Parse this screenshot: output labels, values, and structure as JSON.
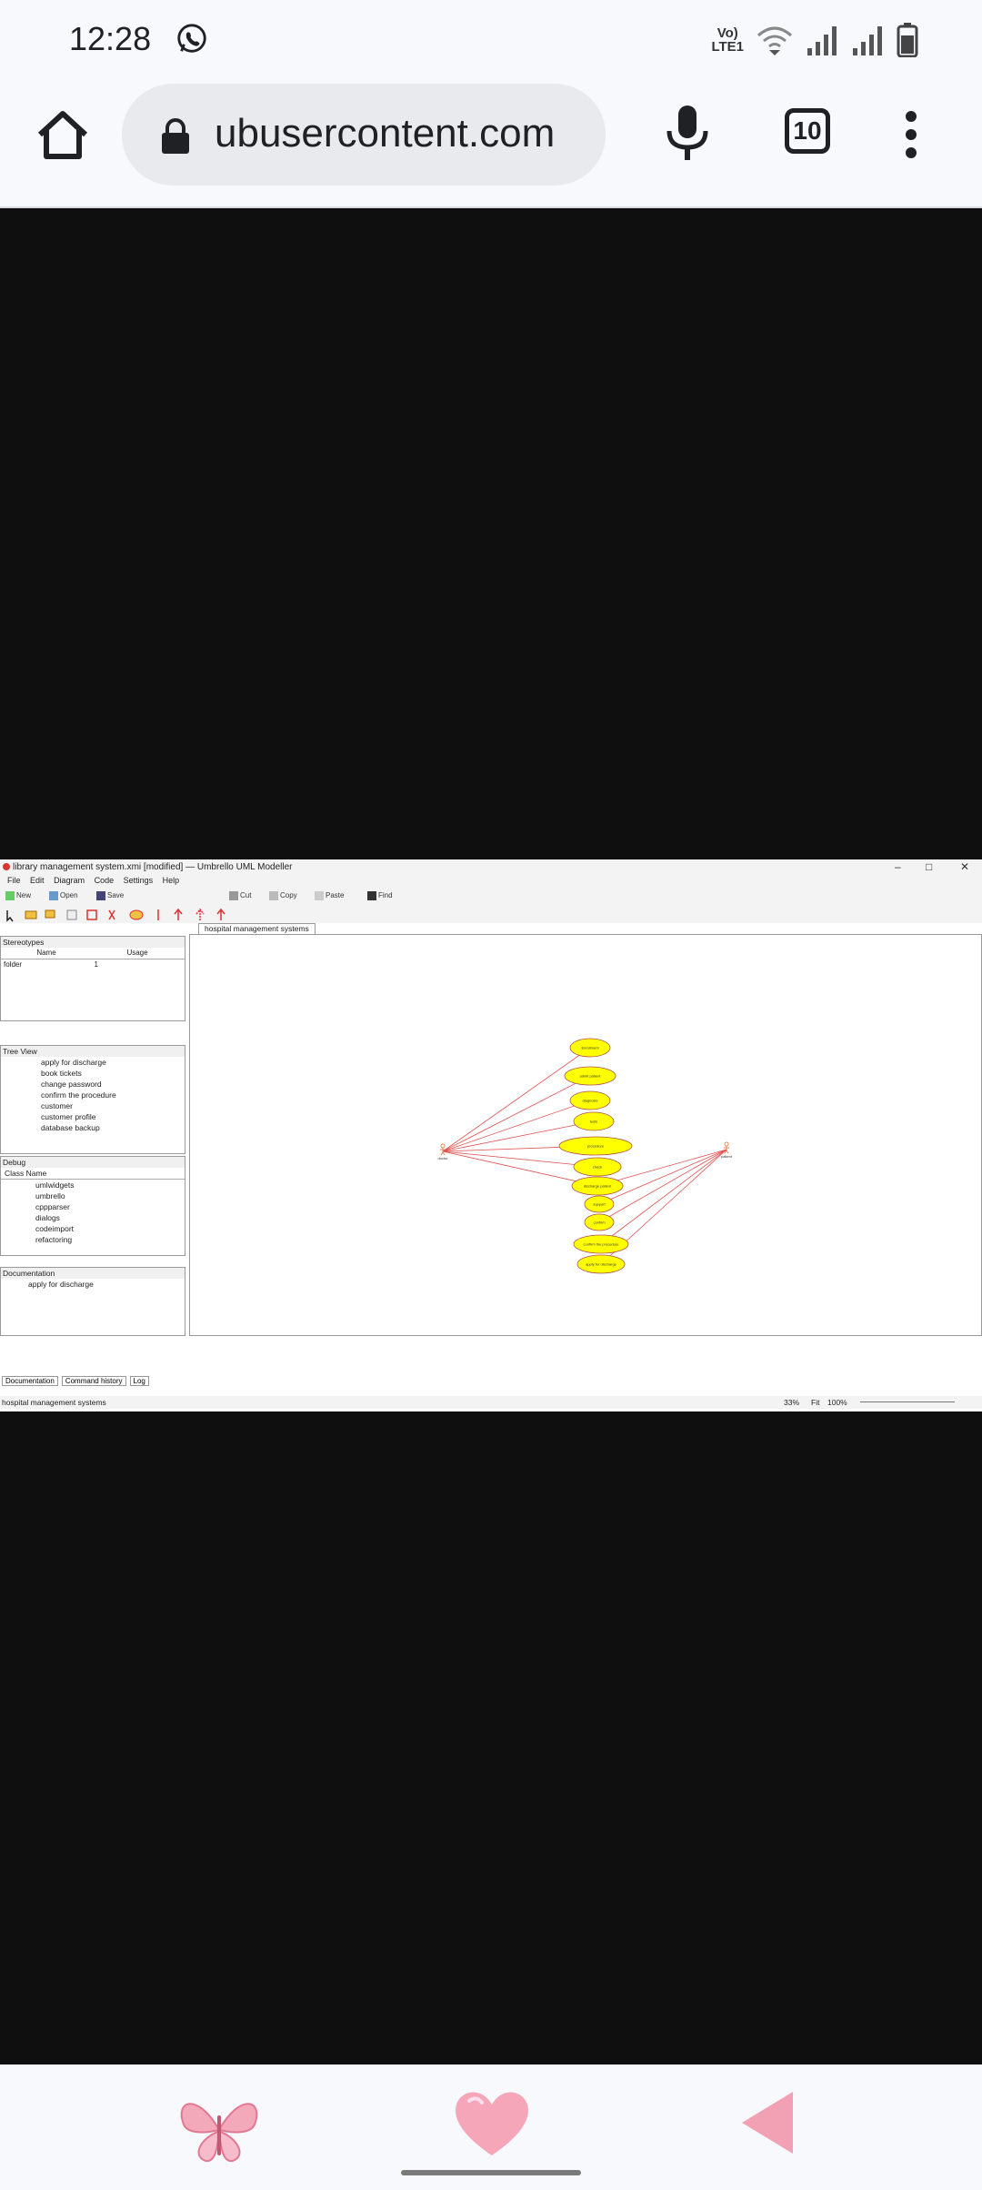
{
  "status_bar": {
    "time": "12:28",
    "app_icon": "whatsapp-icon",
    "volte_label": "Vo)\nLTE1",
    "icons": [
      "volte-icon",
      "wifi-icon",
      "signal-icon",
      "signal-icon",
      "battery-icon"
    ]
  },
  "browser": {
    "home_icon": "home-icon",
    "lock_icon": "lock-icon",
    "url": "ubusercontent.com",
    "mic_icon": "mic-icon",
    "tab_count": "10",
    "menu_icon": "more-vert-icon"
  },
  "embedded_app": {
    "window_title": "library management system.xmi [modified] — Umbrello UML Modeller",
    "window_controls": [
      "–",
      "□",
      "✕"
    ],
    "menu": [
      "File",
      "Edit",
      "Diagram",
      "Code",
      "Settings",
      "Help"
    ],
    "toolbar": [
      "New",
      "Open",
      "Save",
      "Cut",
      "Copy",
      "Paste",
      "Find"
    ],
    "stereotypes_panel": {
      "title": "Stereotypes",
      "columns": [
        "Name",
        "Usage"
      ],
      "rows": [
        [
          "folder",
          "1"
        ]
      ]
    },
    "tree_view": {
      "title": "Tree View",
      "items": [
        "apply for discharge",
        "book tickets",
        "change password",
        "confirm the procedure",
        "customer",
        "customer profile",
        "database backup"
      ]
    },
    "debug_panel": {
      "title": "Debug",
      "column": "Class Name",
      "items": [
        "umlwidgets",
        "umbrello",
        "cppparser",
        "dialogs",
        "codeimport",
        "refactoring"
      ]
    },
    "documentation_panel": {
      "title": "Documentation",
      "value": "apply for discharge",
      "tabs": [
        "Documentation",
        "Command history",
        "Log"
      ]
    },
    "diagram_tab": "hospital management systems",
    "actors": [
      "doctor",
      "patient"
    ],
    "use_cases": [
      "Enrollment",
      "admit patient",
      "diagnosis",
      "tests",
      "procedure",
      "check",
      "discharge patient",
      "support",
      "confirm",
      "confirm the procedure",
      "apply for discharge"
    ],
    "status_text": "hospital management systems",
    "zoom_text": "33%",
    "fit_text": "Fit",
    "zoom_100": "100%"
  },
  "bottom_bar": {
    "icons": [
      "butterfly-icon",
      "heart-icon",
      "back-icon"
    ]
  },
  "colors": {
    "bar_bg": "#f8f9fc",
    "url_bg": "#e8eaee",
    "page_bg": "#0f0f0f",
    "usecase_fill": "#ffff00",
    "assoc_line": "#e05050",
    "pink": "#f1a7b6"
  }
}
